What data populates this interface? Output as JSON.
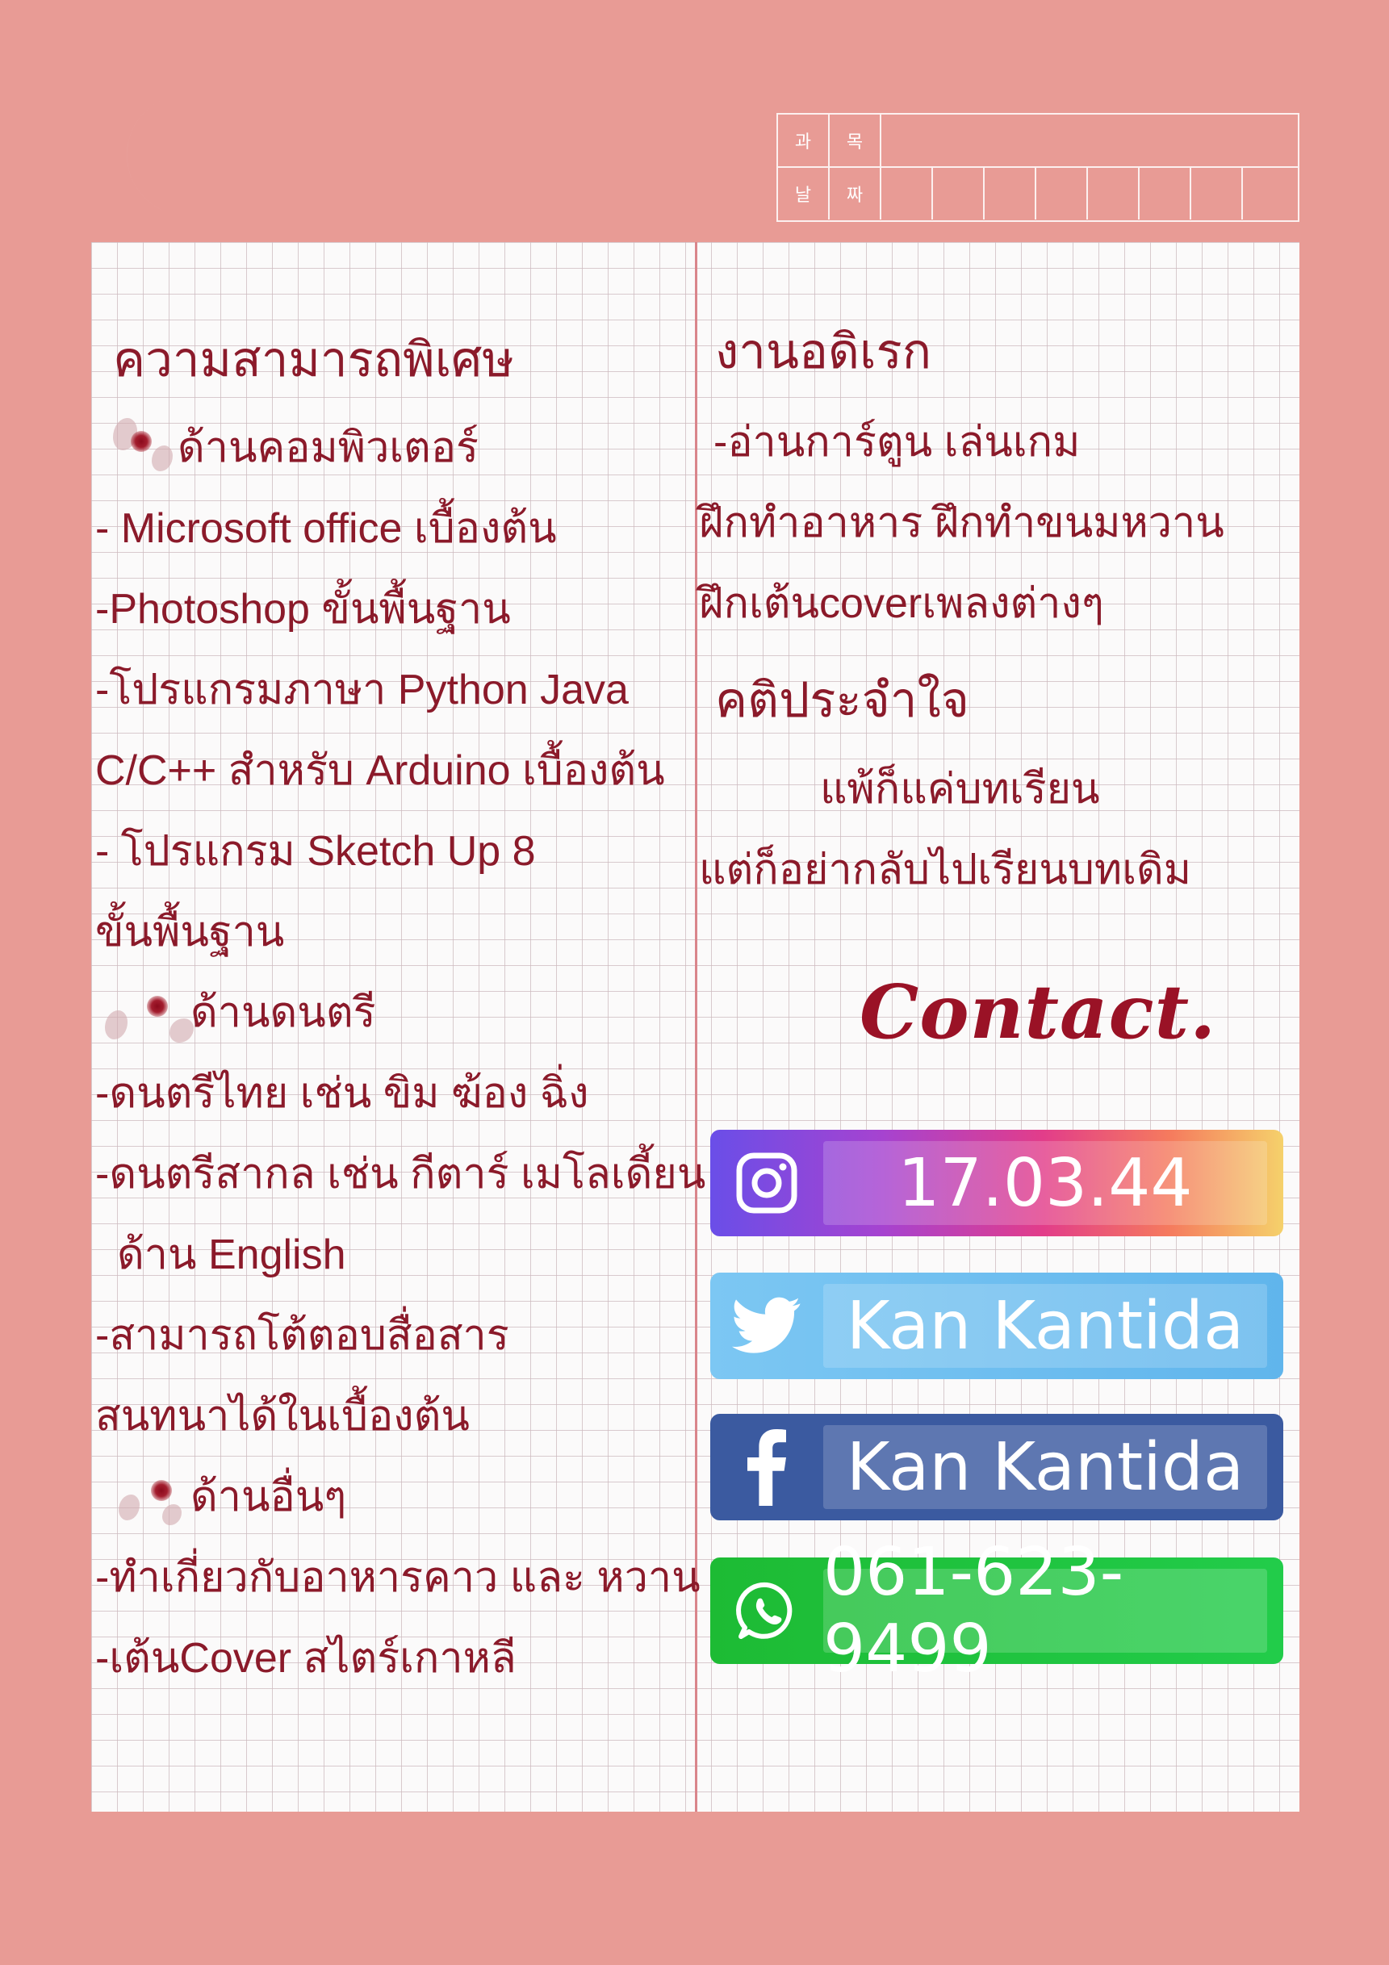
{
  "header": {
    "row1_labels": [
      "과",
      "목"
    ],
    "row2_labels": [
      "날",
      "짜"
    ]
  },
  "left": {
    "title": "ความสามารถพิเศษ",
    "sections": [
      {
        "heading": "ด้านคอมพิวเตอร์",
        "lines": [
          "- Microsoft office เบื้องต้น",
          "-Photoshop ขั้นพื้นฐาน",
          "-โปรแกรมภาษา Python Java",
          "C/C++ สำหรับ Arduino เบื้องต้น",
          "- โปรแกรม Sketch Up 8",
          "ขั้นพื้นฐาน"
        ]
      },
      {
        "heading": "ด้านดนตรี",
        "lines": [
          "-ดนตรีไทย เช่น ขิม ฆ้อง ฉิ่ง",
          "-ดนตรีสากล เช่น กีตาร์ เมโลเดี้ยน"
        ]
      },
      {
        "heading": "ด้าน English",
        "lines": [
          "-สามารถโต้ตอบสื่อสาร",
          "สนทนาได้ในเบื้องต้น"
        ]
      },
      {
        "heading": "ด้านอื่นๆ",
        "lines": [
          "-ทำเกี่ยวกับอาหารคาว และ หวาน",
          "-เต้นCover สไตร์เกาหลี"
        ]
      }
    ]
  },
  "right": {
    "hobby_title": "งานอดิเรก",
    "hobby_lines": [
      "-อ่านการ์ตูน เล่นเกม",
      "ฝึกทำอาหาร ฝึกทำขนมหวาน",
      "ฝึกเต้นcoverเพลงต่างๆ"
    ],
    "motto_title": "คติประจำใจ",
    "motto_lines": [
      "แพ้ก็แค่บทเรียน",
      "แต่ก็อย่ากลับไปเรียนบทเดิม"
    ],
    "contact_title": "Contact."
  },
  "contacts": [
    {
      "icon": "instagram-icon",
      "value": "17.03.44"
    },
    {
      "icon": "twitter-icon",
      "value": "Kan Kantida"
    },
    {
      "icon": "facebook-icon",
      "value": "Kan Kantida"
    },
    {
      "icon": "whatsapp-icon",
      "value": "061-623-9499"
    }
  ],
  "colors": {
    "background": "#e89b95",
    "text": "#8b1a2a",
    "divider": "#d9858b"
  }
}
